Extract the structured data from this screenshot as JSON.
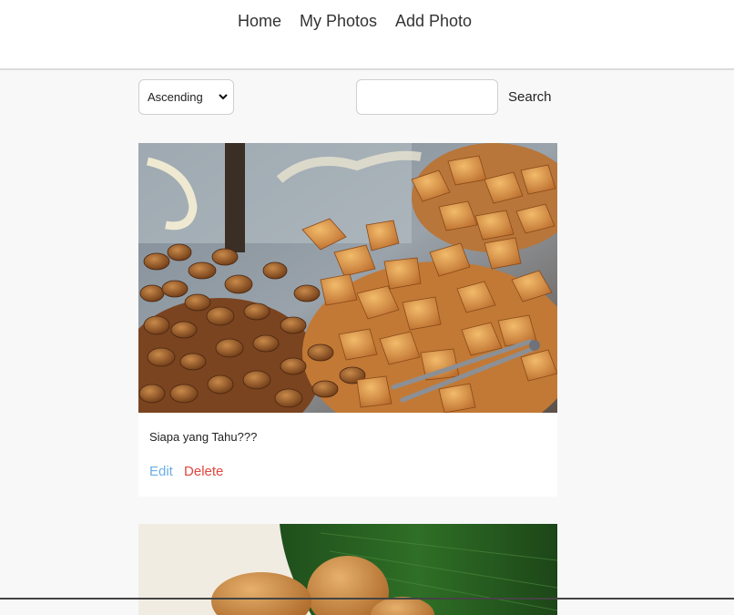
{
  "nav": {
    "home_label": "Home",
    "my_photos_label": "My Photos",
    "add_photo_label": "Add Photo"
  },
  "toolbar": {
    "sort_value": "Ascending",
    "search_value": "",
    "search_button_label": "Search"
  },
  "photos": [
    {
      "caption": "Siapa yang Tahu???",
      "edit_label": "Edit",
      "delete_label": "Delete"
    },
    {
      "caption": ""
    }
  ],
  "colors": {
    "edit_link": "#6aaee6",
    "delete_link": "#e0473f",
    "page_background": "#f8f8f8"
  }
}
